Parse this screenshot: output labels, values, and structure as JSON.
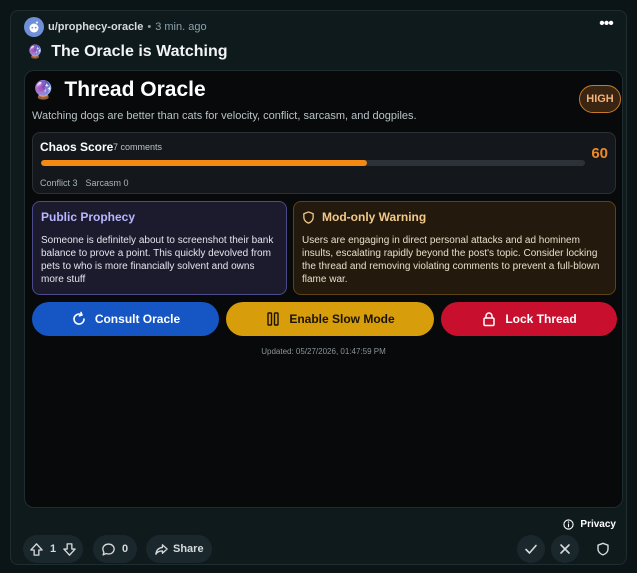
{
  "post": {
    "username": "u/prophecy-oracle",
    "separator": "•",
    "time": "3 min. ago",
    "title_emoji": "🔮",
    "title": "The Oracle is Watching"
  },
  "oracle": {
    "emoji": "🔮",
    "title": "Thread Oracle",
    "badge": "HIGH",
    "subtitle": "Watching dogs are better than cats for velocity, conflict, sarcasm, and dogpiles.",
    "chaos": {
      "label": "Chaos Score",
      "comments": "7 comments",
      "score": "60",
      "score_fraction": 0.6,
      "conflict": "Conflict 3",
      "sarcasm": "Sarcasm 0"
    },
    "prophecy": {
      "title": "Public Prophecy",
      "text": "Someone is definitely about to screenshot their bank balance to prove a point. This quickly devolved from pets to who is more financially solvent and owns more stuff"
    },
    "warning": {
      "title": "Mod-only Warning",
      "text": "Users are engaging in direct personal attacks and ad hominem insults, escalating rapidly beyond the post's topic. Consider locking the thread and removing violating comments to prevent a full-blown flame war."
    },
    "actions": {
      "consult": "Consult Oracle",
      "slow_mode": "Enable Slow Mode",
      "lock": "Lock Thread"
    },
    "updated": "Updated: 05/27/2026, 01:47:59 PM"
  },
  "footer": {
    "privacy": "Privacy",
    "votes": "1",
    "comments": "0",
    "share": "Share"
  },
  "colors": {
    "accent_orange": "#f58a12",
    "consult_blue": "#1556c4",
    "slow_gold": "#d79d0a",
    "lock_red": "#c8102e"
  }
}
